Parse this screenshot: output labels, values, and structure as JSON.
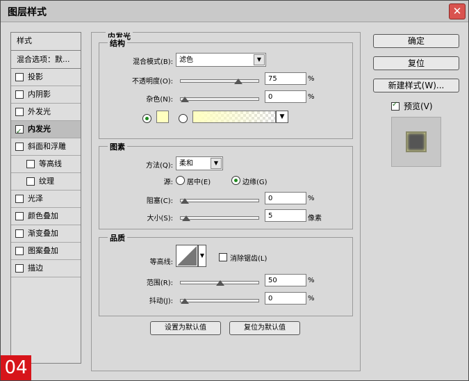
{
  "window": {
    "title": "图层样式",
    "close": "✕"
  },
  "sidebar": {
    "header": "样式",
    "blend_options": "混合选项：默...",
    "items": [
      {
        "label": "投影",
        "checked": false,
        "sub": false,
        "active": false
      },
      {
        "label": "内阴影",
        "checked": false,
        "sub": false,
        "active": false
      },
      {
        "label": "外发光",
        "checked": false,
        "sub": false,
        "active": false
      },
      {
        "label": "内发光",
        "checked": true,
        "sub": false,
        "active": true
      },
      {
        "label": "斜面和浮雕",
        "checked": false,
        "sub": false,
        "active": false
      },
      {
        "label": "等高线",
        "checked": false,
        "sub": true,
        "active": false
      },
      {
        "label": "纹理",
        "checked": false,
        "sub": true,
        "active": false
      },
      {
        "label": "光泽",
        "checked": false,
        "sub": false,
        "active": false
      },
      {
        "label": "颜色叠加",
        "checked": false,
        "sub": false,
        "active": false
      },
      {
        "label": "渐变叠加",
        "checked": false,
        "sub": false,
        "active": false
      },
      {
        "label": "图案叠加",
        "checked": false,
        "sub": false,
        "active": false
      },
      {
        "label": "描边",
        "checked": false,
        "sub": false,
        "active": false
      }
    ]
  },
  "panel": {
    "title": "内发光",
    "structure": {
      "title": "结构",
      "blend_mode_label": "混合模式(B):",
      "blend_mode_value": "滤色",
      "opacity_label": "不透明度(O):",
      "opacity_value": "75",
      "opacity_fraction": 0.75,
      "noise_label": "杂色(N):",
      "noise_value": "0",
      "noise_fraction": 0,
      "percent": "%",
      "glow_color": "#ffffc0"
    },
    "elements": {
      "title": "图素",
      "technique_label": "方法(Q):",
      "technique_value": "柔和",
      "source_label": "源:",
      "source_center": "居中(E)",
      "source_edge": "边缘(G)",
      "choke_label": "阻塞(C):",
      "choke_value": "0",
      "choke_fraction": 0,
      "size_label": "大小(S):",
      "size_value": "5",
      "size_unit": "像素",
      "size_fraction": 0.02
    },
    "quality": {
      "title": "品质",
      "contour_label": "等高线:",
      "antialias_label": "消除锯齿(L)",
      "range_label": "范围(R):",
      "range_value": "50",
      "range_fraction": 0.5,
      "jitter_label": "抖动(J):",
      "jitter_value": "0",
      "jitter_fraction": 0
    },
    "make_default": "设置为默认值",
    "reset_default": "复位为默认值"
  },
  "actions": {
    "ok": "确定",
    "reset": "复位",
    "new_style": "新建样式(W)...",
    "preview": "预览(V)"
  },
  "badge": "04"
}
